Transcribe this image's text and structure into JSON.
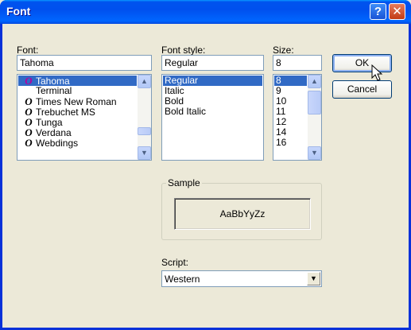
{
  "window": {
    "title": "Font",
    "help_glyph": "?",
    "close_glyph": "✕"
  },
  "font": {
    "label": "Font:",
    "value": "Tahoma",
    "items": [
      {
        "name": "Tahoma",
        "icon": "opentype-icon",
        "selected": true
      },
      {
        "name": "Terminal",
        "icon": "none",
        "selected": false
      },
      {
        "name": "Times New Roman",
        "icon": "truetype-icon",
        "selected": false
      },
      {
        "name": "Trebuchet MS",
        "icon": "truetype-icon",
        "selected": false
      },
      {
        "name": "Tunga",
        "icon": "truetype-icon",
        "selected": false
      },
      {
        "name": "Verdana",
        "icon": "truetype-icon",
        "selected": false
      },
      {
        "name": "Webdings",
        "icon": "truetype-icon",
        "selected": false
      }
    ]
  },
  "style": {
    "label": "Font style:",
    "value": "Regular",
    "items": [
      {
        "name": "Regular",
        "selected": true
      },
      {
        "name": "Italic",
        "selected": false
      },
      {
        "name": "Bold",
        "selected": false
      },
      {
        "name": "Bold Italic",
        "selected": false
      }
    ]
  },
  "size": {
    "label": "Size:",
    "value": "8",
    "items": [
      {
        "name": "8",
        "selected": true
      },
      {
        "name": "9",
        "selected": false
      },
      {
        "name": "10",
        "selected": false
      },
      {
        "name": "11",
        "selected": false
      },
      {
        "name": "12",
        "selected": false
      },
      {
        "name": "14",
        "selected": false
      },
      {
        "name": "16",
        "selected": false
      }
    ]
  },
  "buttons": {
    "ok": "OK",
    "cancel": "Cancel"
  },
  "sample": {
    "label": "Sample",
    "text": "AaBbYyZz"
  },
  "script": {
    "label": "Script:",
    "value": "Western"
  },
  "icons": {
    "font_glyph": "O",
    "scroll_up": "▲",
    "scroll_down": "▼"
  },
  "colors": {
    "titlebar": "#0058ee",
    "selection": "#316ac5",
    "opentype_icon": "#b4009e"
  }
}
